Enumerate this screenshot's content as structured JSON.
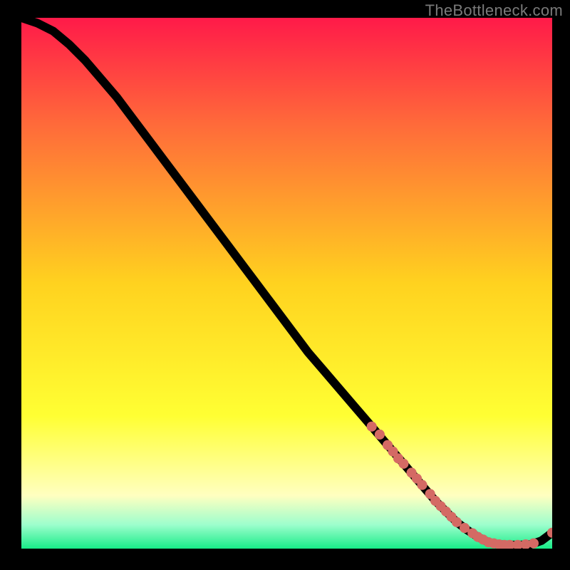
{
  "watermark": "TheBottleneck.com",
  "colors": {
    "background_black": "#000000",
    "gradient_top": "#ff1a49",
    "gradient_mid1": "#ff6a3a",
    "gradient_mid2": "#ffd21f",
    "gradient_mid3": "#ffff33",
    "gradient_bottom_yellow": "#ffffc0",
    "gradient_green_light": "#9dfecd",
    "gradient_green": "#18ec88",
    "curve": "#000000",
    "markers": "#d46a64"
  },
  "chart_data": {
    "type": "line",
    "title": "",
    "xlabel": "",
    "ylabel": "",
    "xlim": [
      0,
      100
    ],
    "ylim": [
      0,
      100
    ],
    "grid": false,
    "legend": false,
    "series": [
      {
        "name": "curve",
        "x": [
          0,
          3,
          6,
          9,
          12,
          15,
          18,
          21,
          24,
          27,
          30,
          33,
          36,
          39,
          42,
          45,
          48,
          51,
          54,
          57,
          60,
          63,
          66,
          69,
          72,
          75,
          78,
          80,
          82,
          84,
          86,
          88,
          90,
          92,
          94,
          96,
          98,
          100
        ],
        "y": [
          100,
          99,
          97.5,
          95,
          92,
          88.5,
          85,
          81,
          77,
          73,
          69,
          65,
          61,
          57,
          53,
          49,
          45,
          41,
          37,
          33.5,
          30,
          26.5,
          23,
          19.5,
          16,
          12.5,
          9,
          7,
          5,
          3.5,
          2.2,
          1.2,
          0.8,
          0.7,
          0.7,
          0.8,
          1.5,
          3
        ]
      }
    ],
    "markers": [
      {
        "x": 66,
        "y": 23
      },
      {
        "x": 67.5,
        "y": 21.5
      },
      {
        "x": 69,
        "y": 19.5
      },
      {
        "x": 70,
        "y": 18.3
      },
      {
        "x": 71,
        "y": 17
      },
      {
        "x": 72,
        "y": 16
      },
      {
        "x": 73.5,
        "y": 14.3
      },
      {
        "x": 74.5,
        "y": 13.2
      },
      {
        "x": 75.5,
        "y": 12.0
      },
      {
        "x": 77,
        "y": 10.3
      },
      {
        "x": 78,
        "y": 9.0
      },
      {
        "x": 79,
        "y": 8.0
      },
      {
        "x": 80,
        "y": 7.0
      },
      {
        "x": 81,
        "y": 6.0
      },
      {
        "x": 82,
        "y": 5.0
      },
      {
        "x": 83.5,
        "y": 3.9
      },
      {
        "x": 85,
        "y": 2.9
      },
      {
        "x": 86,
        "y": 2.2
      },
      {
        "x": 87,
        "y": 1.7
      },
      {
        "x": 88,
        "y": 1.2
      },
      {
        "x": 89,
        "y": 1.0
      },
      {
        "x": 90,
        "y": 0.8
      },
      {
        "x": 91,
        "y": 0.7
      },
      {
        "x": 92,
        "y": 0.7
      },
      {
        "x": 93.5,
        "y": 0.7
      },
      {
        "x": 95,
        "y": 0.8
      },
      {
        "x": 96.5,
        "y": 1.0
      },
      {
        "x": 100,
        "y": 3.0
      }
    ]
  }
}
